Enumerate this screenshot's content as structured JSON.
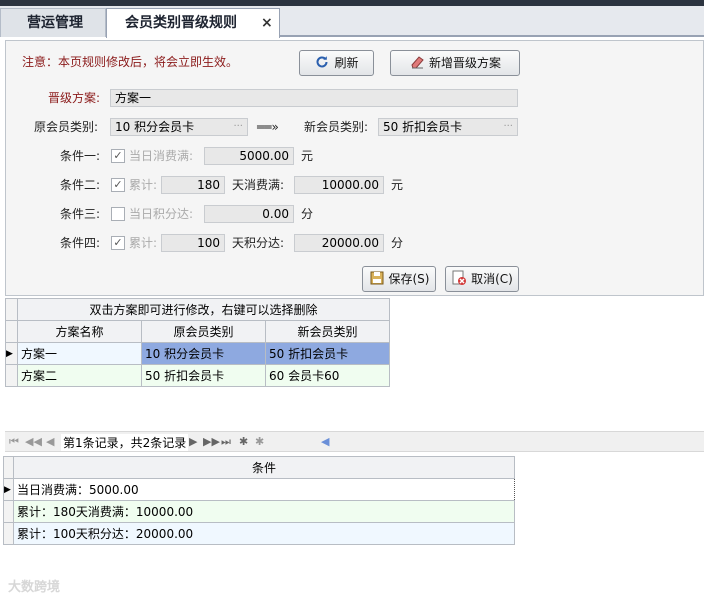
{
  "tabs": [
    {
      "label": "营运管理"
    },
    {
      "label": "会员类别晋级规则",
      "close": "×"
    }
  ],
  "notice": "注意：本页规则修改后，将会立即生效。",
  "buttons": {
    "refresh": "刷新",
    "add_plan": "新增晋级方案",
    "save": "保存(S)",
    "cancel": "取消(C)"
  },
  "form": {
    "plan_label": "晋级方案:",
    "plan_value": "方案一",
    "orig_type_label": "原会员类别:",
    "orig_type_value": "10 积分会员卡",
    "arrow": "══»",
    "new_type_label": "新会员类别:",
    "new_type_value": "50 折扣会员卡",
    "cond1": {
      "label": "条件一:",
      "check_label": "当日消费满:",
      "value": "5000.00",
      "unit": "元",
      "checked": true
    },
    "cond2": {
      "label": "条件二:",
      "check_label": "累计:",
      "days": "180",
      "mid": "天消费满:",
      "value": "10000.00",
      "unit": "元",
      "checked": true
    },
    "cond3": {
      "label": "条件三:",
      "check_label": "当日积分达:",
      "value": "0.00",
      "unit": "分",
      "checked": false
    },
    "cond4": {
      "label": "条件四:",
      "check_label": "累计:",
      "days": "100",
      "mid": "天积分达:",
      "value": "20000.00",
      "unit": "分",
      "checked": true
    }
  },
  "plan_grid": {
    "caption": "双击方案即可进行修改，右键可以选择删除",
    "headers": [
      "方案名称",
      "原会员类别",
      "新会员类别"
    ],
    "rows": [
      [
        "方案一",
        "10 积分会员卡",
        "50 折扣会员卡"
      ],
      [
        "方案二",
        "50 折扣会员卡",
        "60 会员卡60"
      ]
    ]
  },
  "navigator": {
    "record_text": "第1条记录，共2条记录"
  },
  "cond_grid": {
    "header": "条件",
    "rows": [
      "当日消费满：5000.00",
      "累计：180天消费满：10000.00",
      "累计：100天积分达：20000.00"
    ]
  },
  "watermark": "大数跨境",
  "colors": {
    "selected_row": "#8ea9e0",
    "alt_row": "#f0f8ff",
    "note_red": "#8b1a1a"
  }
}
